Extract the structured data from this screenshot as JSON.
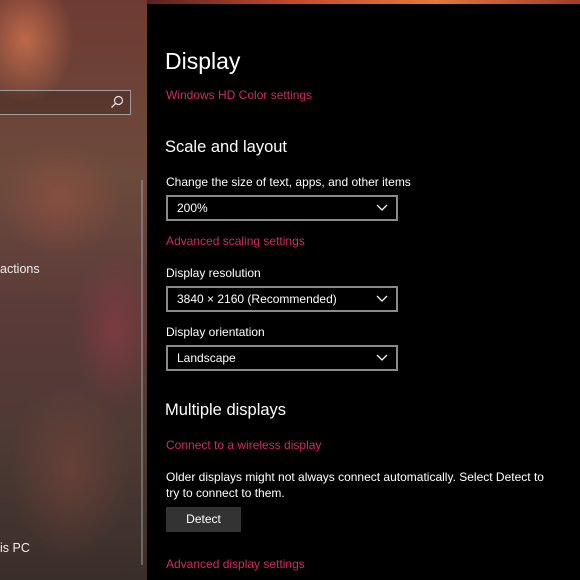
{
  "sidebar": {
    "items": [
      {
        "label": "actions"
      },
      {
        "label": "is PC"
      }
    ]
  },
  "display": {
    "title": "Display",
    "hd_color_link": "Windows HD Color settings"
  },
  "scale_layout": {
    "heading": "Scale and layout",
    "text_size_label": "Change the size of text, apps, and other items",
    "text_size_value": "200%",
    "advanced_scaling_link": "Advanced scaling settings",
    "resolution_label": "Display resolution",
    "resolution_value": "3840 × 2160 (Recommended)",
    "orientation_label": "Display orientation",
    "orientation_value": "Landscape"
  },
  "multiple_displays": {
    "heading": "Multiple displays",
    "wireless_link": "Connect to a wireless display",
    "description": "Older displays might not always connect automatically. Select Detect to try to connect to them.",
    "detect_button": "Detect",
    "advanced_display_link": "Advanced display settings"
  },
  "colors": {
    "accent_link": "#d22a5e",
    "background": "#000000",
    "button_bg": "#333333"
  },
  "icons": {
    "search": "search-icon",
    "chevron": "chevron-down-icon"
  }
}
